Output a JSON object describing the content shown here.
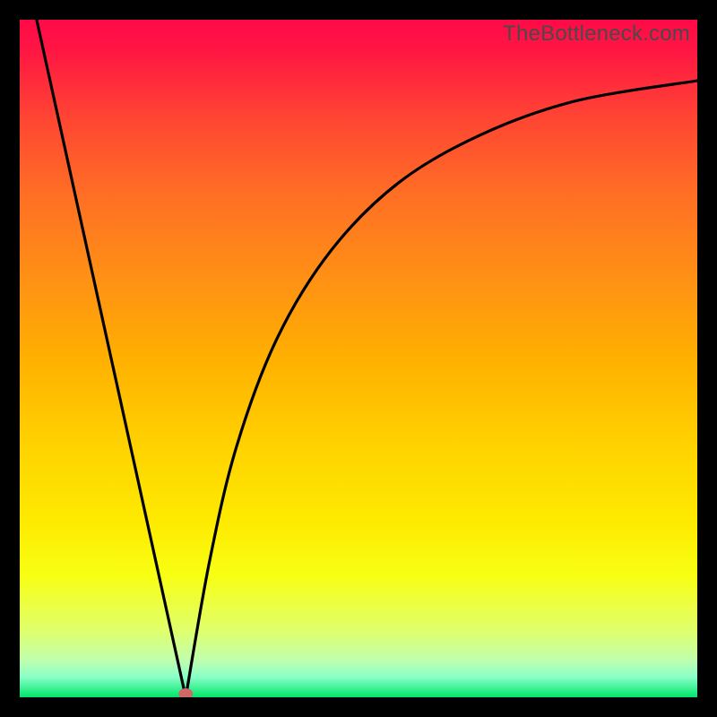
{
  "watermark": "TheBottleneck.com",
  "chart_data": {
    "type": "line",
    "title": "",
    "xlabel": "",
    "ylabel": "",
    "x_range": [
      0,
      100
    ],
    "y_range": [
      0,
      100
    ],
    "description": "Bottleneck percentage curve with a V-shaped minimum. Y-axis implied bottleneck percent (0 at bottom = optimal, 100 at top = severe). X-axis implied hardware performance index.",
    "curve": {
      "left_branch": [
        {
          "x": 2.5,
          "y": 100
        },
        {
          "x": 24.5,
          "y": 0
        }
      ],
      "right_branch": [
        {
          "x": 24.5,
          "y": 0
        },
        {
          "x": 28,
          "y": 20
        },
        {
          "x": 32,
          "y": 37
        },
        {
          "x": 38,
          "y": 53
        },
        {
          "x": 46,
          "y": 66
        },
        {
          "x": 56,
          "y": 76
        },
        {
          "x": 68,
          "y": 83
        },
        {
          "x": 82,
          "y": 88
        },
        {
          "x": 100,
          "y": 91
        }
      ]
    },
    "minimum_point": {
      "x": 24.5,
      "y": 0
    },
    "grid": false,
    "legend": false
  },
  "colors": {
    "frame": "#000000",
    "curve": "#000000",
    "dot": "#d06868"
  }
}
